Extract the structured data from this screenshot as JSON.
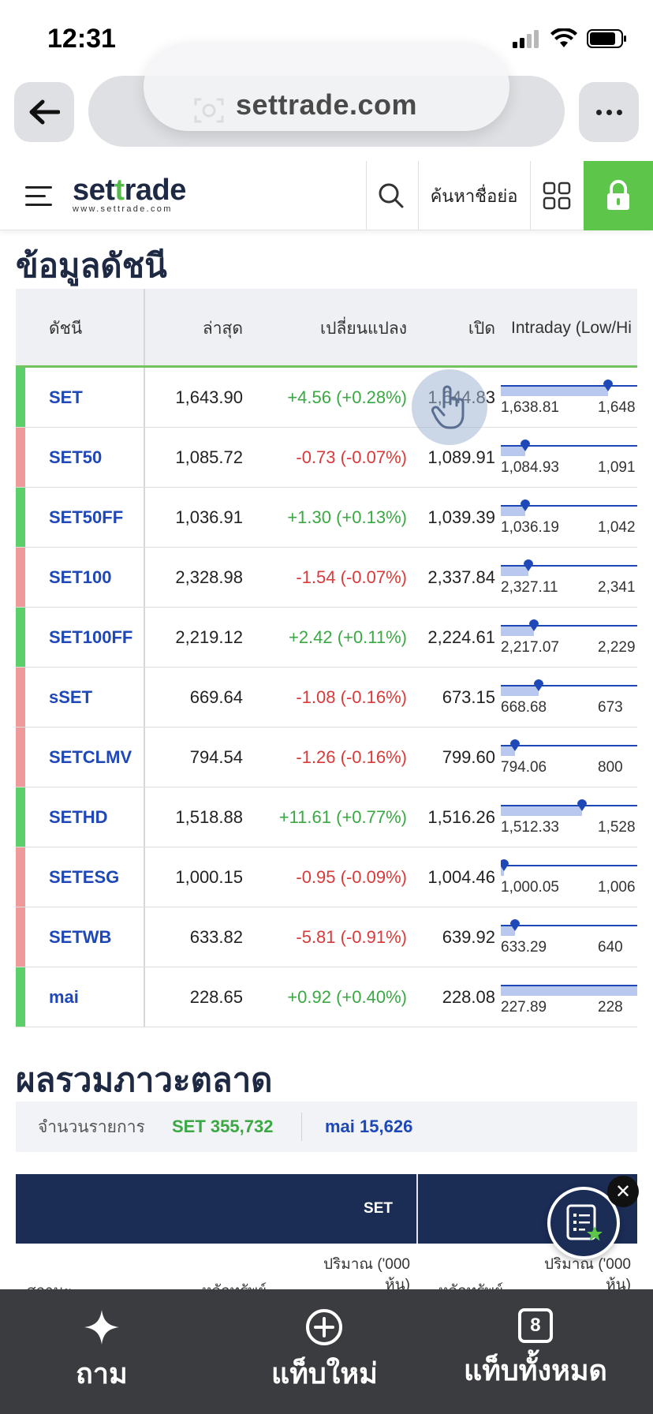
{
  "status": {
    "time": "12:31"
  },
  "browser": {
    "url": "settrade.com"
  },
  "header": {
    "logo_main_a": "set",
    "logo_main_t": "t",
    "logo_main_b": "rade",
    "logo_sub": "www.settrade.com",
    "search_label": "ค้นหาชื่อย่อ"
  },
  "index_section": {
    "title": "ข้อมูลดัชนี",
    "columns": [
      "ดัชนี",
      "ล่าสุด",
      "เปลี่ยนแปลง",
      "เปิด",
      "Intraday (Low/Hi"
    ],
    "rows": [
      {
        "name": "SET",
        "last": "1,643.90",
        "change": "+4.56 (+0.28%)",
        "open": "1,644.83",
        "low": "1,638.81",
        "high": "1,648",
        "dir": "up",
        "position": 0.62
      },
      {
        "name": "SET50",
        "last": "1,085.72",
        "change": "-0.73 (-0.07%)",
        "open": "1,089.91",
        "low": "1,084.93",
        "high": "1,091",
        "dir": "down",
        "position": 0.14
      },
      {
        "name": "SET50FF",
        "last": "1,036.91",
        "change": "+1.30 (+0.13%)",
        "open": "1,039.39",
        "low": "1,036.19",
        "high": "1,042",
        "dir": "up",
        "position": 0.14
      },
      {
        "name": "SET100",
        "last": "2,328.98",
        "change": "-1.54 (-0.07%)",
        "open": "2,337.84",
        "low": "2,327.11",
        "high": "2,341",
        "dir": "down",
        "position": 0.16
      },
      {
        "name": "SET100FF",
        "last": "2,219.12",
        "change": "+2.42 (+0.11%)",
        "open": "2,224.61",
        "low": "2,217.07",
        "high": "2,229",
        "dir": "up",
        "position": 0.19
      },
      {
        "name": "sSET",
        "last": "669.64",
        "change": "-1.08 (-0.16%)",
        "open": "673.15",
        "low": "668.68",
        "high": "673",
        "dir": "down",
        "position": 0.22
      },
      {
        "name": "SETCLMV",
        "last": "794.54",
        "change": "-1.26 (-0.16%)",
        "open": "799.60",
        "low": "794.06",
        "high": "800",
        "dir": "down",
        "position": 0.08
      },
      {
        "name": "SETHD",
        "last": "1,518.88",
        "change": "+11.61 (+0.77%)",
        "open": "1,516.26",
        "low": "1,512.33",
        "high": "1,528",
        "dir": "up",
        "position": 0.47
      },
      {
        "name": "SETESG",
        "last": "1,000.15",
        "change": "-0.95 (-0.09%)",
        "open": "1,004.46",
        "low": "1,000.05",
        "high": "1,006",
        "dir": "down",
        "position": 0.02
      },
      {
        "name": "SETWB",
        "last": "633.82",
        "change": "-5.81 (-0.91%)",
        "open": "639.92",
        "low": "633.29",
        "high": "640",
        "dir": "down",
        "position": 0.08
      },
      {
        "name": "mai",
        "last": "228.65",
        "change": "+0.92 (+0.40%)",
        "open": "228.08",
        "low": "227.89",
        "high": "228",
        "dir": "up",
        "position": 0.88
      }
    ]
  },
  "market_summary": {
    "title": "ผลรวมภาวะตลาด",
    "count_label": "จำนวนรายการ",
    "set_count": "SET 355,732",
    "mai_count": "mai 15,626",
    "table_header": "SET",
    "sub_cols": [
      "สถานะ",
      "หลักทรัพย์",
      "ปริมาณ ('000 หุ้น)",
      "หลักทรัพย์",
      "ปริมาณ ('000 หุ้น)"
    ]
  },
  "bottom_bar": {
    "ask_label": "ถาม",
    "new_tab_label": "แท็บใหม่",
    "all_tabs_label": "แท็บทั้งหมด",
    "tab_count": "8"
  },
  "colors": {
    "up": "#5ccf6a",
    "down": "#ef9a9a",
    "brand_green": "#5cc54a",
    "navy": "#1b2c55"
  }
}
